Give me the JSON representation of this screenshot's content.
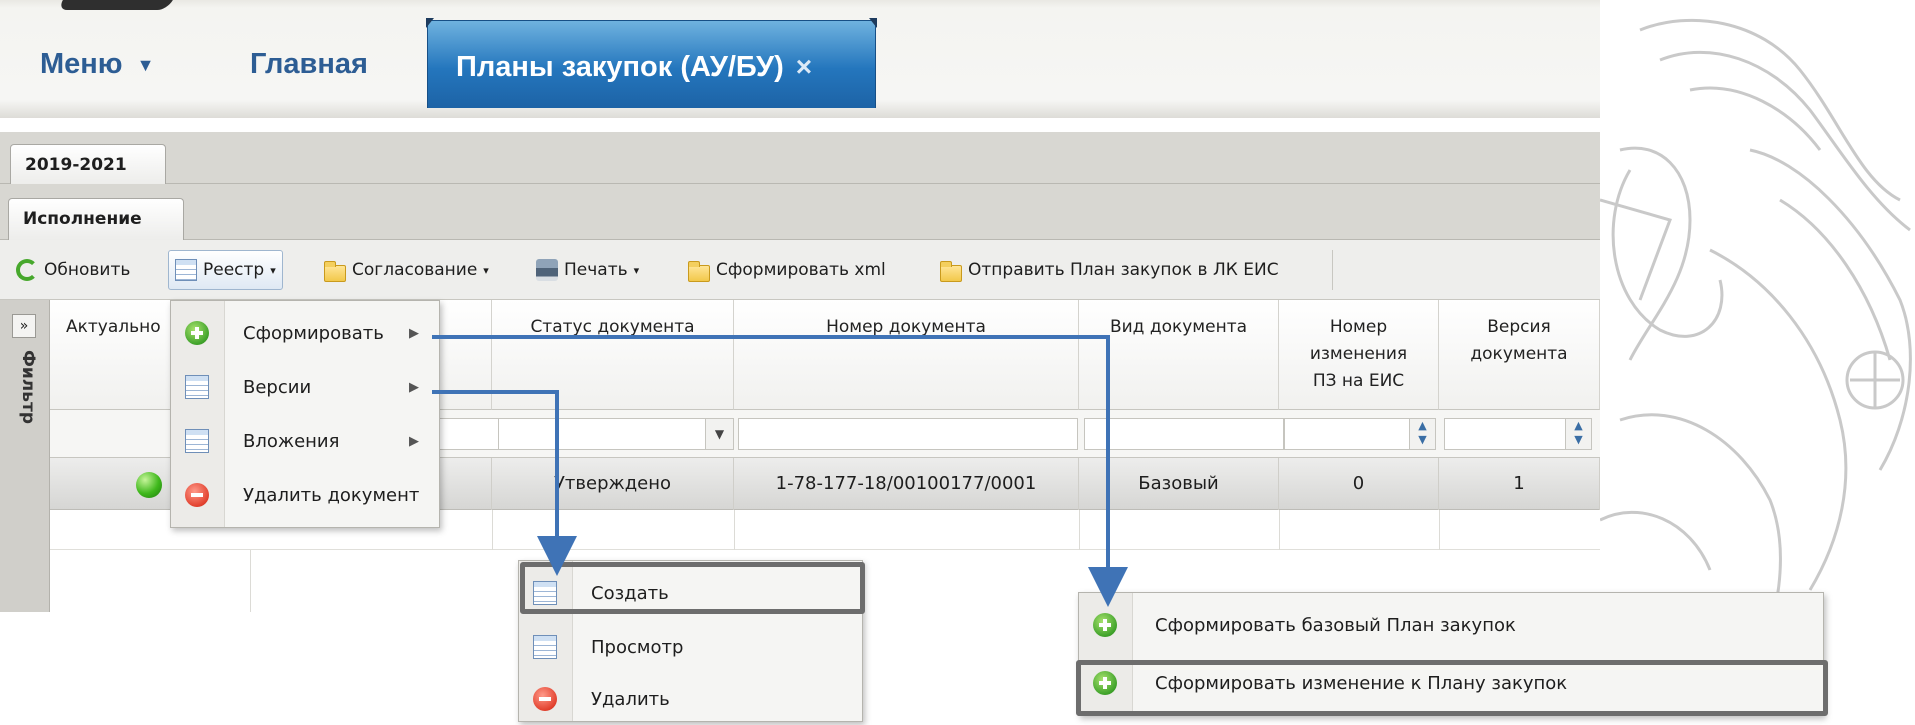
{
  "nav": {
    "menu_label": "Меню",
    "home_label": "Главная",
    "active_tab_label": "Планы закупок (АУ/БУ)",
    "close_glyph": "×",
    "caret_glyph": "▼"
  },
  "subtabs": {
    "year": "2019-2021",
    "section": "Исполнение"
  },
  "toolbar": {
    "refresh": "Обновить",
    "registry": "Реестр",
    "approval": "Согласование",
    "print": "Печать",
    "xml": "Сформировать xml",
    "send": "Отправить План закупок в ЛК ЕИС",
    "dd_glyph": "▾"
  },
  "grid": {
    "filter_label": "Фильтр",
    "expand_glyph": "»",
    "columns": [
      "Актуально",
      "Статус документа",
      "Номер документа",
      "Вид документа",
      "Номер изменения ПЗ на ЕИС",
      "Версия документа"
    ],
    "row": {
      "status": "Утверждено",
      "number": "1-78-177-18/00100177/0001",
      "kind": "Базовый",
      "change_no": "0",
      "version": "1"
    }
  },
  "registry_menu": {
    "items": [
      "Сформировать",
      "Версии",
      "Вложения",
      "Удалить документ"
    ],
    "submenu_glyph": "▶"
  },
  "versions_menu": {
    "items": [
      "Создать",
      "Просмотр",
      "Удалить"
    ]
  },
  "form_menu": {
    "items": [
      "Сформировать базовый План закупок",
      "Сформировать изменение к Плану закупок"
    ]
  },
  "colors": {
    "nav_text": "#2d5d94",
    "active_tab": "#2476bd",
    "arrow": "#3f73b6",
    "highlight_box": "#6d6d6d"
  }
}
